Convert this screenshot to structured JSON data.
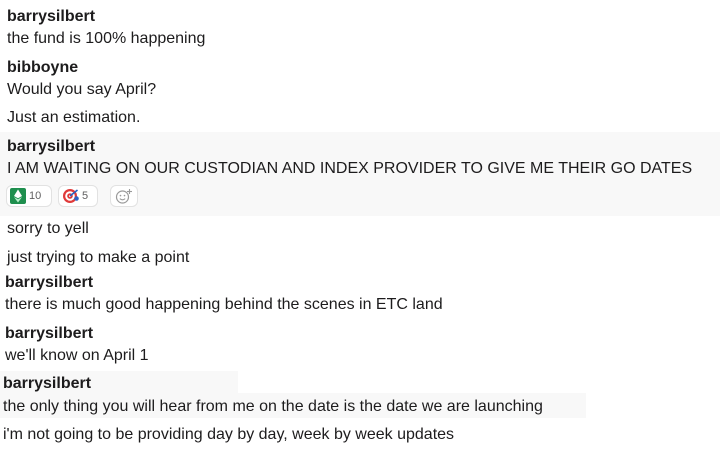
{
  "messages": [
    {
      "author": "barrysilbert",
      "lines": [
        "the fund is 100% happening"
      ]
    },
    {
      "author": "bibboyne",
      "lines": [
        "Would you say April?",
        "Just an estimation."
      ]
    },
    {
      "author": "barrysilbert",
      "lines": [
        "I AM WAITING ON OUR CUSTODIAN AND INDEX PROVIDER TO GIVE ME THEIR GO DATES"
      ],
      "reactions": [
        {
          "icon": "ethereum-classic-icon",
          "count": "10"
        },
        {
          "icon": "target-icon",
          "count": "5"
        }
      ],
      "add_reaction_icon": "add-reaction-icon"
    },
    {
      "author": "",
      "lines": [
        "sorry to yell",
        "just trying to make a point"
      ]
    },
    {
      "author": "barrysilbert",
      "lines": [
        "there is much good happening behind the scenes in ETC land"
      ]
    },
    {
      "author": "barrysilbert",
      "lines": [
        "we'll know on April 1"
      ]
    },
    {
      "author": "barrysilbert",
      "lines": [
        "the only thing you will hear from me on the date is the date we are launching",
        "i'm not going to be providing day by day, week by week updates"
      ]
    }
  ],
  "colors": {
    "text": "#1d1c1d",
    "highlight": "#f8f8f8",
    "reaction_border": "#e2e2e2",
    "reaction_count": "#616061"
  }
}
